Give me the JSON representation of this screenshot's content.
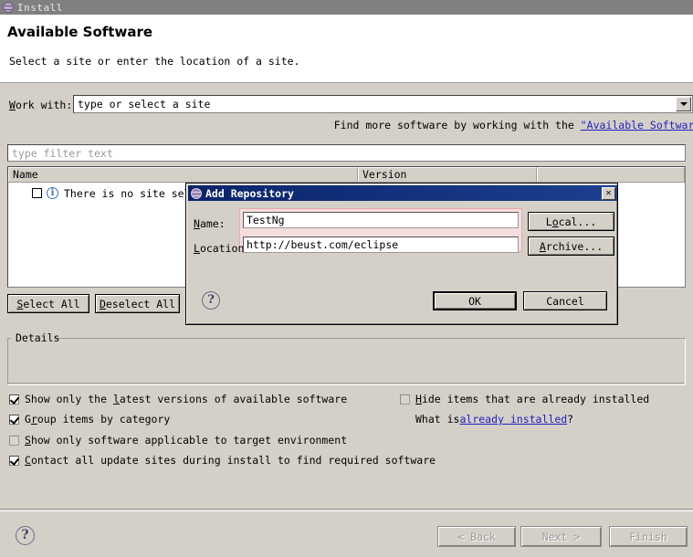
{
  "window": {
    "title": "Install",
    "icon": "globe-icon"
  },
  "header": {
    "title": "Available Software",
    "subtitle": "Select a site or enter the location of a site."
  },
  "work_with": {
    "label_prefix": "W",
    "label_mnemonic": "W",
    "label": "ork with:",
    "value": "type or select a site",
    "dropdown_icon": "chevron-down-icon"
  },
  "find_more": {
    "text_before": "Find more software by working with the ",
    "link": "\"Available Software Sit"
  },
  "filter": {
    "placeholder": "type filter text"
  },
  "table": {
    "columns": [
      "Name",
      "Version",
      ""
    ],
    "rows": [
      {
        "checked": false,
        "icon": "info-icon",
        "name": "There is no site selec"
      }
    ]
  },
  "tree_buttons": {
    "select_all_mnemonic": "S",
    "select_all_rest": "elect All",
    "deselect_all_mnemonic": "D",
    "deselect_all_rest": "eselect All"
  },
  "details": {
    "label": "Details",
    "content": ""
  },
  "options_left": [
    {
      "checked": true,
      "pre": "Show only the ",
      "mnemonic": "l",
      "post": "atest versions of available software"
    },
    {
      "checked": true,
      "pre": "G",
      "mnemonic": "r",
      "post": "oup items by category"
    },
    {
      "checked": false,
      "pre": "",
      "mnemonic": "S",
      "post": "how only software applicable to target environment"
    },
    {
      "checked": true,
      "pre": "",
      "mnemonic": "C",
      "post": "ontact all update sites during install to find required software"
    }
  ],
  "options_right": {
    "hide_installed": {
      "checked": false,
      "mnemonic": "H",
      "rest": "ide items that are already installed"
    },
    "what_is_prefix": "What is ",
    "what_is_link": "already installed",
    "what_is_suffix": "?"
  },
  "wizard_buttons": {
    "help_icon": "question-mark-icon",
    "back": "< Back",
    "next": "Next >",
    "finish": "Finish"
  },
  "dialog": {
    "title": "Add Repository",
    "icon": "globe-icon",
    "close_icon": "close-icon",
    "name_mnemonic": "N",
    "name_label_rest": "ame:",
    "name_value": "TestNg",
    "location_mnemonic": "L",
    "location_label_rest": "ocation:",
    "location_value": "http://beust.com/eclipse",
    "local_mnemonic_pre": "L",
    "local_mnemonic": "o",
    "local_rest": "cal...",
    "archive_mnemonic": "A",
    "archive_rest": "rchive...",
    "ok": "OK",
    "cancel": "Cancel",
    "help_icon": "question-mark-icon"
  },
  "colors": {
    "dialog_title_bg": "#0a246a",
    "window_title_bg": "#808080",
    "face": "#d4d0c8",
    "error_field_border": "#e5a8a8",
    "link": "#2020c0"
  }
}
